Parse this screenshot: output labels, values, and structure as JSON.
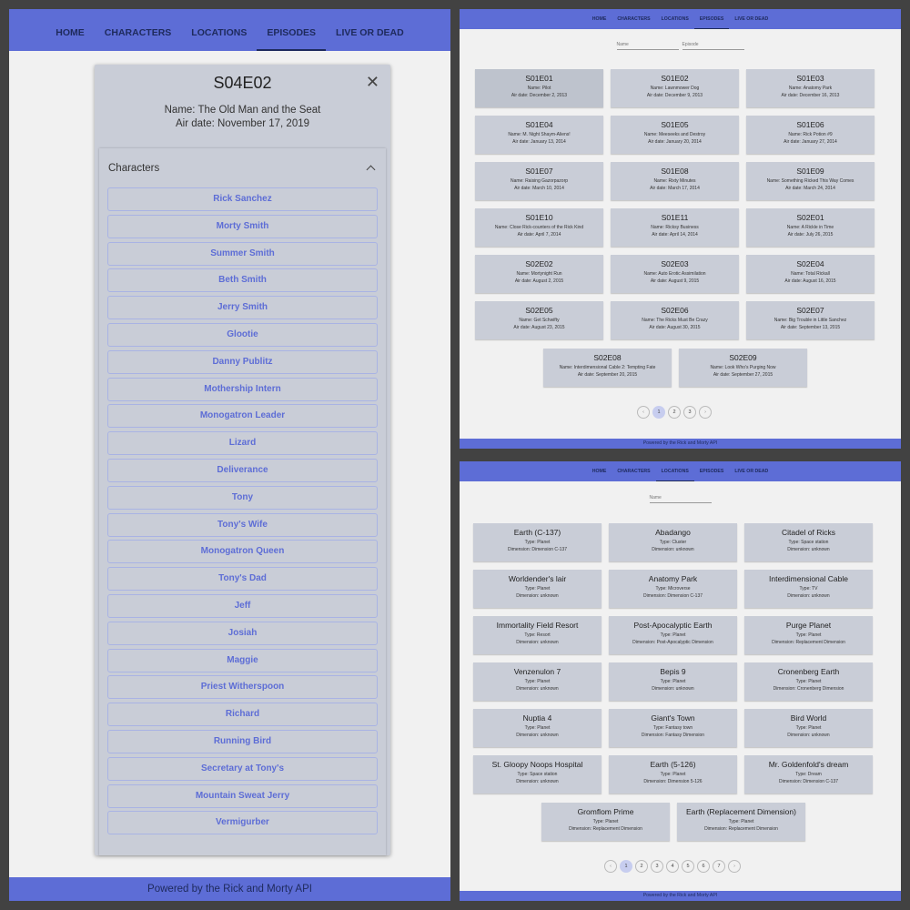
{
  "nav": {
    "items": [
      "HOME",
      "CHARACTERS",
      "LOCATIONS",
      "EPISODES",
      "LIVE OR DEAD"
    ]
  },
  "footer": "Powered by the Rick and Morty API",
  "modal": {
    "title": "S04E02",
    "close": "✕",
    "name": "Name: The Old Man and the Seat",
    "air_date": "Air date: November 17, 2019",
    "accordion_label": "Characters",
    "characters": [
      "Rick Sanchez",
      "Morty Smith",
      "Summer Smith",
      "Beth Smith",
      "Jerry Smith",
      "Glootie",
      "Danny Publitz",
      "Mothership Intern",
      "Monogatron Leader",
      "Lizard",
      "Deliverance",
      "Tony",
      "Tony's Wife",
      "Monogatron Queen",
      "Tony's Dad",
      "Jeff",
      "Josiah",
      "Maggie",
      "Priest Witherspoon",
      "Richard",
      "Running Bird",
      "Secretary at Tony's",
      "Mountain Sweat Jerry",
      "Vermigurber"
    ]
  },
  "episodes_page": {
    "filters": [
      "Name",
      "Episode"
    ],
    "cards": [
      {
        "title": "S01E01",
        "name": "Name: Pilot",
        "air": "Air date: December 2, 2013"
      },
      {
        "title": "S01E02",
        "name": "Name: Lawnmower Dog",
        "air": "Air date: December 9, 2013"
      },
      {
        "title": "S01E03",
        "name": "Name: Anatomy Park",
        "air": "Air date: December 16, 2013"
      },
      {
        "title": "S01E04",
        "name": "Name: M. Night Shaym-Aliens!",
        "air": "Air date: January 13, 2014"
      },
      {
        "title": "S01E05",
        "name": "Name: Meeseeks and Destroy",
        "air": "Air date: January 20, 2014"
      },
      {
        "title": "S01E06",
        "name": "Name: Rick Potion #9",
        "air": "Air date: January 27, 2014"
      },
      {
        "title": "S01E07",
        "name": "Name: Raising Gazorpazorp",
        "air": "Air date: March 10, 2014"
      },
      {
        "title": "S01E08",
        "name": "Name: Rixty Minutes",
        "air": "Air date: March 17, 2014"
      },
      {
        "title": "S01E09",
        "name": "Name: Something Ricked This Way Comes",
        "air": "Air date: March 24, 2014"
      },
      {
        "title": "S01E10",
        "name": "Name: Close Rick-counters of the Rick Kind",
        "air": "Air date: April 7, 2014"
      },
      {
        "title": "S01E11",
        "name": "Name: Ricksy Business",
        "air": "Air date: April 14, 2014"
      },
      {
        "title": "S02E01",
        "name": "Name: A Rickle in Time",
        "air": "Air date: July 26, 2015"
      },
      {
        "title": "S02E02",
        "name": "Name: Mortynight Run",
        "air": "Air date: August 2, 2015"
      },
      {
        "title": "S02E03",
        "name": "Name: Auto Erotic Assimilation",
        "air": "Air date: August 9, 2015"
      },
      {
        "title": "S02E04",
        "name": "Name: Total Rickall",
        "air": "Air date: August 16, 2015"
      },
      {
        "title": "S02E05",
        "name": "Name: Get Schwifty",
        "air": "Air date: August 23, 2015"
      },
      {
        "title": "S02E06",
        "name": "Name: The Ricks Must Be Crazy",
        "air": "Air date: August 30, 2015"
      },
      {
        "title": "S02E07",
        "name": "Name: Big Trouble in Little Sanchez",
        "air": "Air date: September 13, 2015"
      },
      {
        "title": "S02E08",
        "name": "Name: Interdimensional Cable 2: Tempting Fate",
        "air": "Air date: September 20, 2015"
      },
      {
        "title": "S02E09",
        "name": "Name: Look Who's Purging Now",
        "air": "Air date: September 27, 2015"
      }
    ],
    "pagination": {
      "prev": "‹",
      "pages": [
        "1",
        "2",
        "3"
      ],
      "next": "›",
      "current": "1"
    }
  },
  "locations_page": {
    "filters": [
      "Name"
    ],
    "cards": [
      {
        "title": "Earth (C-137)",
        "type": "Type: Planet",
        "dim": "Dimension: Dimension C-137"
      },
      {
        "title": "Abadango",
        "type": "Type: Cluster",
        "dim": "Dimension: unknown"
      },
      {
        "title": "Citadel of Ricks",
        "type": "Type: Space station",
        "dim": "Dimension: unknown"
      },
      {
        "title": "Worldender's lair",
        "type": "Type: Planet",
        "dim": "Dimension: unknown"
      },
      {
        "title": "Anatomy Park",
        "type": "Type: Microverse",
        "dim": "Dimension: Dimension C-137"
      },
      {
        "title": "Interdimensional Cable",
        "type": "Type: TV",
        "dim": "Dimension: unknown"
      },
      {
        "title": "Immortality Field Resort",
        "type": "Type: Resort",
        "dim": "Dimension: unknown"
      },
      {
        "title": "Post-Apocalyptic Earth",
        "type": "Type: Planet",
        "dim": "Dimension: Post-Apocalyptic Dimension"
      },
      {
        "title": "Purge Planet",
        "type": "Type: Planet",
        "dim": "Dimension: Replacement Dimension"
      },
      {
        "title": "Venzenulon 7",
        "type": "Type: Planet",
        "dim": "Dimension: unknown"
      },
      {
        "title": "Bepis 9",
        "type": "Type: Planet",
        "dim": "Dimension: unknown"
      },
      {
        "title": "Cronenberg Earth",
        "type": "Type: Planet",
        "dim": "Dimension: Cronenberg Dimension"
      },
      {
        "title": "Nuptia 4",
        "type": "Type: Planet",
        "dim": "Dimension: unknown"
      },
      {
        "title": "Giant's Town",
        "type": "Type: Fantasy town",
        "dim": "Dimension: Fantasy Dimension"
      },
      {
        "title": "Bird World",
        "type": "Type: Planet",
        "dim": "Dimension: unknown"
      },
      {
        "title": "St. Gloopy Noops Hospital",
        "type": "Type: Space station",
        "dim": "Dimension: unknown"
      },
      {
        "title": "Earth (5-126)",
        "type": "Type: Planet",
        "dim": "Dimension: Dimension 5-126"
      },
      {
        "title": "Mr. Goldenfold's dream",
        "type": "Type: Dream",
        "dim": "Dimension: Dimension C-137"
      },
      {
        "title": "Gromflom Prime",
        "type": "Type: Planet",
        "dim": "Dimension: Replacement Dimension"
      },
      {
        "title": "Earth (Replacement Dimension)",
        "type": "Type: Planet",
        "dim": "Dimension: Replacement Dimension"
      }
    ],
    "pagination": {
      "prev": "‹",
      "pages": [
        "1",
        "2",
        "3",
        "4",
        "5",
        "6",
        "7"
      ],
      "next": "›",
      "current": "1"
    }
  },
  "colors": {
    "navbar": "#5d6dd6",
    "card": "#c9cdd7",
    "accent_text": "#5d6dd6"
  }
}
